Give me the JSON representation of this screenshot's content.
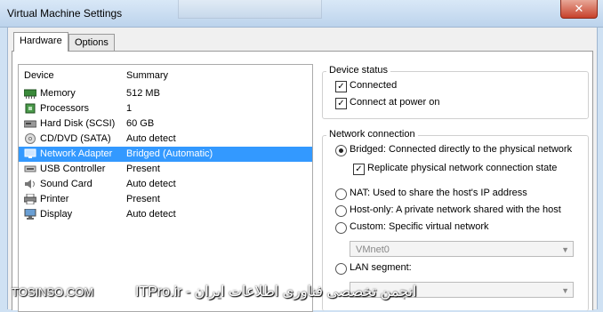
{
  "window": {
    "title": "Virtual Machine Settings",
    "close_glyph": "✕"
  },
  "tabs": [
    {
      "label": "Hardware",
      "active": true
    },
    {
      "label": "Options",
      "active": false
    }
  ],
  "device_list": {
    "col_device": "Device",
    "col_summary": "Summary",
    "rows": [
      {
        "icon": "memory-icon",
        "name": "Memory",
        "summary": "512 MB",
        "selected": false
      },
      {
        "icon": "processor-icon",
        "name": "Processors",
        "summary": "1",
        "selected": false
      },
      {
        "icon": "hard-disk-icon",
        "name": "Hard Disk (SCSI)",
        "summary": "60 GB",
        "selected": false
      },
      {
        "icon": "cd-dvd-icon",
        "name": "CD/DVD (SATA)",
        "summary": "Auto detect",
        "selected": false
      },
      {
        "icon": "network-adapter-icon",
        "name": "Network Adapter",
        "summary": "Bridged (Automatic)",
        "selected": true
      },
      {
        "icon": "usb-icon",
        "name": "USB Controller",
        "summary": "Present",
        "selected": false
      },
      {
        "icon": "sound-card-icon",
        "name": "Sound Card",
        "summary": "Auto detect",
        "selected": false
      },
      {
        "icon": "printer-icon",
        "name": "Printer",
        "summary": "Present",
        "selected": false
      },
      {
        "icon": "display-icon",
        "name": "Display",
        "summary": "Auto detect",
        "selected": false
      }
    ]
  },
  "device_status": {
    "title": "Device status",
    "connected": "Connected",
    "connect_at_power_on": "Connect at power on"
  },
  "network_connection": {
    "title": "Network connection",
    "bridged": "Bridged: Connected directly to the physical network",
    "replicate": "Replicate physical network connection state",
    "nat": "NAT: Used to share the host's IP address",
    "host_only": "Host-only: A private network shared with the host",
    "custom": "Custom: Specific virtual network",
    "vmnet_value": "VMnet0",
    "lan_segment": "LAN segment:",
    "lan_value": ""
  },
  "watermark": {
    "left": "TOSINSO.COM",
    "right": "انجمن تخصصی فناوری اطلاعات ایران - ITPro.ir"
  },
  "colors": {
    "selection": "#3399ff",
    "titlebar": "#bcd3ec",
    "close": "#c7412b"
  }
}
